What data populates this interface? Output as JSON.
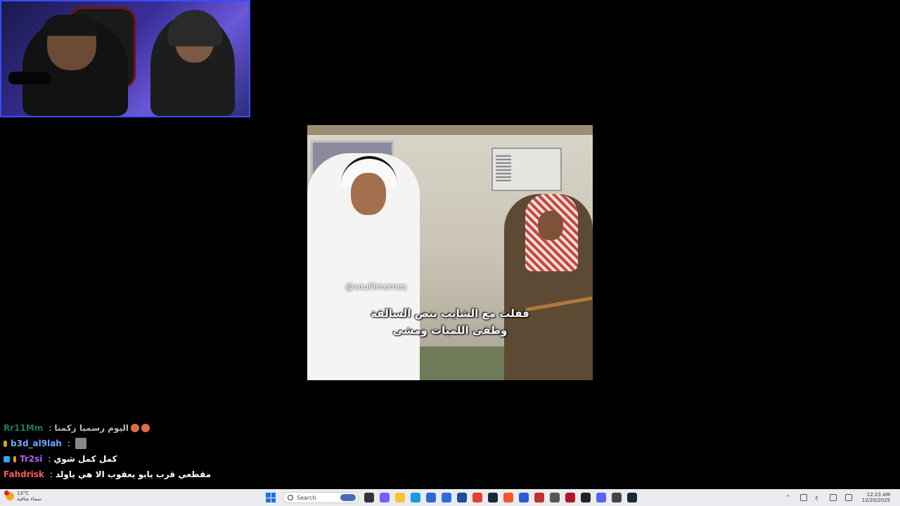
{
  "video": {
    "watermark": "@soulllmemes",
    "subtitle_line1": "قفلت مع الشايب بنص السالفة",
    "subtitle_line2": "وطفى اللمبات ومشى"
  },
  "chat": [
    {
      "user": "Rr11Mm",
      "user_color": "#1f7a5a",
      "badge_color": "",
      "message": "اليوم رسميا زكمنا",
      "extras": "emoji"
    },
    {
      "user": "b3d_al9lah",
      "user_color": "#6fa8ff",
      "badge_color": "#d4a017",
      "message": "",
      "extras": "emote"
    },
    {
      "user": "Tr2si",
      "user_color": "#b55cff",
      "badge_color": "#2aa7ff",
      "message": "كمل كمل شوي",
      "extras": ""
    },
    {
      "user": "Fahdrisk",
      "user_color": "#ff5a5a",
      "badge_color": "",
      "message": "مقطعي قرب يابو يعقوب الا هي ياولد",
      "extras": ""
    }
  ],
  "taskbar": {
    "weather_temp": "13°C",
    "weather_desc": "سماء صافية",
    "search_placeholder": "Search",
    "apps": [
      {
        "name": "file-explorer-icon",
        "color": "#333"
      },
      {
        "name": "copilot-icon",
        "color": "#7b5cff"
      },
      {
        "name": "folder-icon",
        "color": "#f4c430"
      },
      {
        "name": "edge-icon",
        "color": "#1a9be0"
      },
      {
        "name": "store-icon",
        "color": "#2d6bd4"
      },
      {
        "name": "vpn-icon",
        "color": "#2b6fd6"
      },
      {
        "name": "security-icon",
        "color": "#1a4f9c"
      },
      {
        "name": "chrome-icon",
        "color": "#e34133"
      },
      {
        "name": "steam-icon",
        "color": "#1b2838"
      },
      {
        "name": "brave-icon",
        "color": "#fb542b"
      },
      {
        "name": "vegas-icon",
        "color": "#2f5bd3"
      },
      {
        "name": "game-icon",
        "color": "#c4302b"
      },
      {
        "name": "tool-icon",
        "color": "#555"
      },
      {
        "name": "record-icon",
        "color": "#b0152a"
      },
      {
        "name": "capcut-icon",
        "color": "#222"
      },
      {
        "name": "discord-icon",
        "color": "#5865f2"
      },
      {
        "name": "app-icon",
        "color": "#444"
      },
      {
        "name": "steam2-icon",
        "color": "#1b2838"
      }
    ],
    "time": "12:23 AM",
    "date": "12/20/2025"
  }
}
